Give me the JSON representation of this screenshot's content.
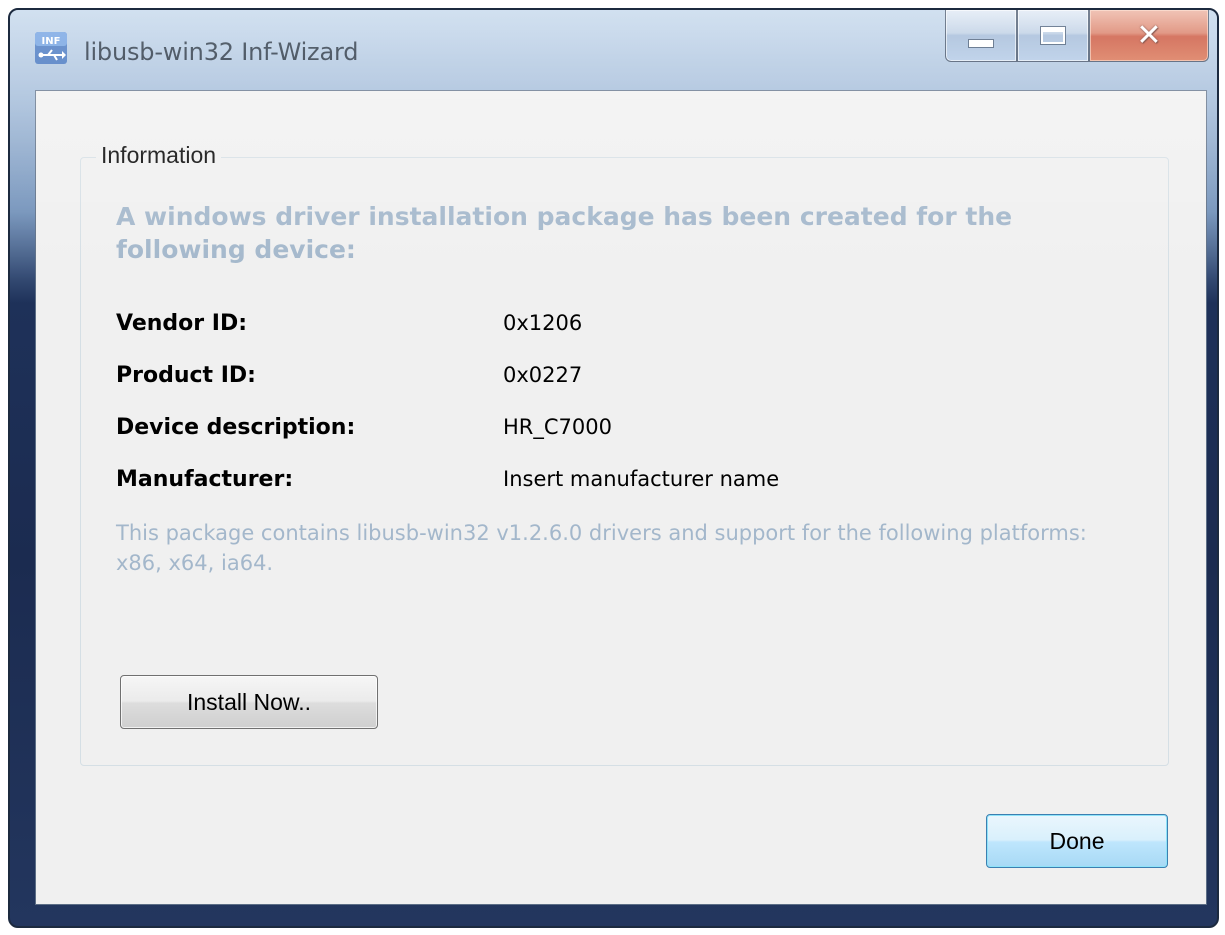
{
  "window": {
    "title": "libusb-win32 Inf-Wizard",
    "icon": "inf-usb-icon",
    "caption_buttons": {
      "minimize": "minimize-icon",
      "maximize": "maximize-icon",
      "close": "close-icon"
    }
  },
  "info_group": {
    "legend": "Information",
    "headline": "A windows driver installation package has been created for the following device:",
    "rows": [
      {
        "label": "Vendor ID:",
        "value": "0x1206"
      },
      {
        "label": "Product ID:",
        "value": "0x0227"
      },
      {
        "label": "Device description:",
        "value": "HR_C7000"
      },
      {
        "label": "Manufacturer:",
        "value": "Insert manufacturer name"
      }
    ],
    "note": "This package contains libusb-win32 v1.2.6.0 drivers and support for the following platforms: x86, x64, ia64.",
    "install_button": "Install Now.."
  },
  "footer": {
    "done_button": "Done"
  },
  "colors": {
    "accent_text": "#a3b7cb",
    "dialog_bg": "#f0f0f0",
    "close_button": "#c2381b"
  }
}
